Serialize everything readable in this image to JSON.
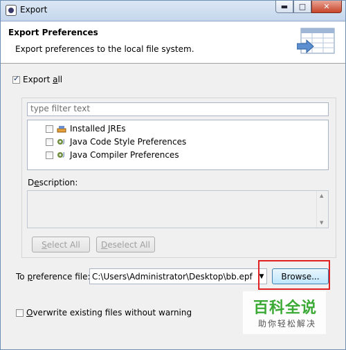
{
  "window": {
    "title": "Export",
    "minimize_label": "▬",
    "maximize_label": "□",
    "close_label": "✕"
  },
  "banner": {
    "title": "Export Preferences",
    "description": "Export preferences to the local file system."
  },
  "export_all": {
    "label_pre": "Export ",
    "label_mnemonic": "a",
    "label_post": "ll",
    "checked": true
  },
  "filter": {
    "placeholder": "type filter text"
  },
  "tree_items": [
    {
      "label": "Installed JREs",
      "icon": "jre-icon"
    },
    {
      "label": "Java Code Style Preferences",
      "icon": "java-prefs-icon"
    },
    {
      "label": "Java Compiler Preferences",
      "icon": "java-prefs-icon"
    }
  ],
  "description": {
    "label_pre": "D",
    "label_mnemonic": "e",
    "label_post": "scription:"
  },
  "buttons": {
    "select_all_mnemonic": "S",
    "select_all_rest": "elect All",
    "deselect_all_mnemonic": "D",
    "deselect_all_rest": "eselect All",
    "browse": "Browse..."
  },
  "pref_file": {
    "label_pre": "To ",
    "label_mnemonic": "p",
    "label_post": "reference file:",
    "value": "C:\\Users\\Administrator\\Desktop\\bb.epf"
  },
  "overwrite": {
    "label_mnemonic": "O",
    "label_rest": "verwrite existing files without warning",
    "checked": false
  },
  "watermark": {
    "main": "百科全说",
    "sub": "助你轻松解决"
  },
  "colors": {
    "highlight": "#e02020",
    "watermark": "#3aaa35"
  }
}
